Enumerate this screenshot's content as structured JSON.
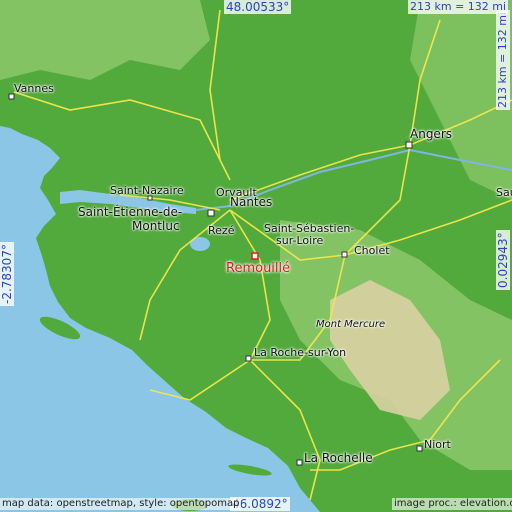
{
  "coords": {
    "top": "48.00533°",
    "bottom": "46.0892°",
    "left": "-2.78307°",
    "right": "0.02943°"
  },
  "scale": "213 km = 132 mi",
  "main_place": "Remouillé",
  "places": {
    "vannes": "Vannes",
    "angers": "Angers",
    "saint_nazaire": "Saint-Nazaire",
    "orvault": "Orvault",
    "nantes": "Nantes",
    "saint_etienne": "Saint-Étienne-de-",
    "montluc": "Montluc",
    "reze": "Rezé",
    "saint_sebastien_1": "Saint-Sébastien-",
    "saint_sebastien_2": "sur-Loire",
    "cholet": "Cholet",
    "mont_mercure": "Mont Mercure",
    "la_roche": "La Roche-sur-Yon",
    "niort": "Niort",
    "la_rochelle": "La Rochelle",
    "sau": "Sau"
  },
  "credits": {
    "left": "map data: openstreetmap, style: opentopomap",
    "right": "image proc.: elevation.city"
  },
  "colors": {
    "sea": "#8cc6e6",
    "lowland": "#52a93c",
    "upland": "#8cc86a",
    "highland": "#d9d1a2",
    "road": "#f2e84a",
    "accent": "#e21b1b",
    "coord_text": "#2a42c8"
  }
}
